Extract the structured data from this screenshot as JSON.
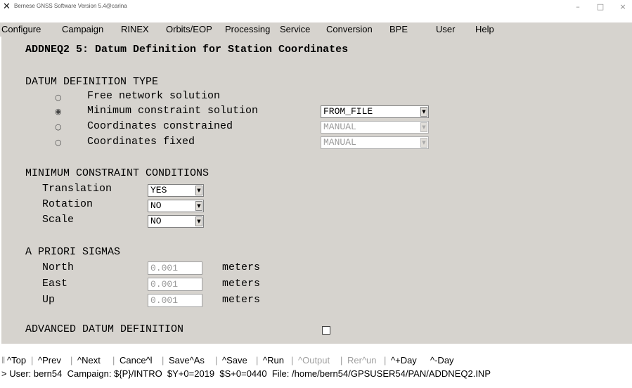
{
  "window": {
    "title": "Bernese GNSS Software Version 5.4@carina",
    "icon": "x-app-icon",
    "controls": {
      "minimize": "–",
      "maximize": "□",
      "close": "×"
    }
  },
  "menu": [
    "Configure",
    "Campaign",
    "RINEX",
    "Orbits/EOP",
    "Processing",
    "Service",
    "Conversion",
    "BPE",
    "User",
    "Help"
  ],
  "panel": {
    "title": "ADDNEQ2 5: Datum Definition for Station Coordinates",
    "datum_type": {
      "heading": "DATUM DEFINITION TYPE",
      "options": [
        {
          "label": "Free network solution",
          "selected": false
        },
        {
          "label": "Minimum constraint solution",
          "selected": true
        },
        {
          "label": "Coordinates constrained",
          "selected": false
        },
        {
          "label": "Coordinates fixed",
          "selected": false
        }
      ],
      "selects": [
        {
          "value": "FROM_FILE",
          "enabled": true
        },
        {
          "value": "MANUAL",
          "enabled": false
        },
        {
          "value": "MANUAL",
          "enabled": false
        }
      ]
    },
    "min_constraint": {
      "heading": "MINIMUM CONSTRAINT CONDITIONS",
      "rows": [
        {
          "label": "Translation",
          "value": "YES"
        },
        {
          "label": "Rotation",
          "value": "NO"
        },
        {
          "label": "Scale",
          "value": "NO"
        }
      ]
    },
    "sigmas": {
      "heading": "A PRIORI SIGMAS",
      "rows": [
        {
          "label": "North",
          "value": "0.001",
          "unit": "meters"
        },
        {
          "label": "East",
          "value": "0.001",
          "unit": "meters"
        },
        {
          "label": "Up",
          "value": "0.001",
          "unit": "meters"
        }
      ]
    },
    "advanced": {
      "label": "ADVANCED DATUM DEFINITION",
      "checked": false
    }
  },
  "toolbar": [
    {
      "label": "^Top",
      "enabled": true
    },
    {
      "label": "^Prev",
      "enabled": true
    },
    {
      "label": "^Next",
      "enabled": true
    },
    {
      "label": "Cance^l",
      "enabled": true
    },
    {
      "label": "Save^As",
      "enabled": true
    },
    {
      "label": "^Save",
      "enabled": true
    },
    {
      "label": "^Run",
      "enabled": true
    },
    {
      "label": "^Output",
      "enabled": false
    },
    {
      "label": "Rer^un",
      "enabled": false
    },
    {
      "label": "^+Day",
      "enabled": true
    },
    {
      "label": "^-Day",
      "enabled": true
    }
  ],
  "status": "> User: bern54  Campaign: ${P}/INTRO  $Y+0=2019  $S+0=0440  File: /home/bern54/GPSUSER54/PAN/ADDNEQ2.INP"
}
